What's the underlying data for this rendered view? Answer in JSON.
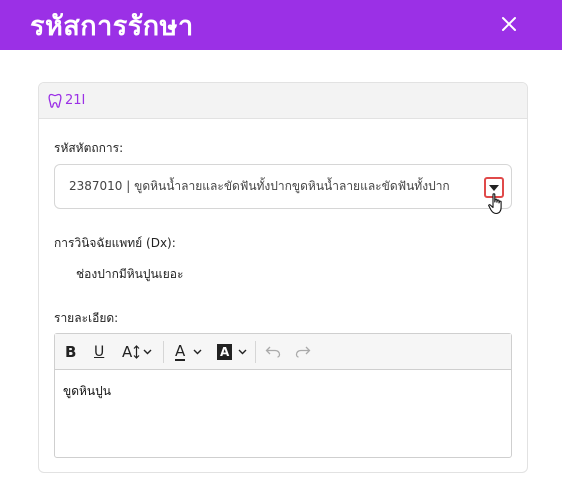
{
  "header": {
    "title": "รหัสการรักษา"
  },
  "card": {
    "tooth_number": "21I",
    "procedure_label": "รหัสหัตถการ:",
    "procedure_value": "2387010 | ขูดหินน้ำลายและขัดฟันทั้งปากขูดหินน้ำลายและขัดฟันทั้งปาก",
    "dx_label": "การวินิจฉัยแพทย์ (Dx):",
    "dx_value": "ช่องปากมีหินปูนเยอะ",
    "detail_label": "รายละเอียด:",
    "editor_content": "ขูดหินปูน"
  },
  "toolbar": {
    "bold": "B",
    "underline": "U",
    "font_size": "A",
    "text_color": "A",
    "highlight": "A"
  },
  "colors": {
    "brand": "#9b30e6",
    "focus_ring": "#e04a4a"
  },
  "icons": [
    "close-icon",
    "tooth-icon",
    "caret-down-icon",
    "hand-pointer-icon",
    "chevron-down-icon",
    "undo-icon",
    "redo-icon"
  ]
}
